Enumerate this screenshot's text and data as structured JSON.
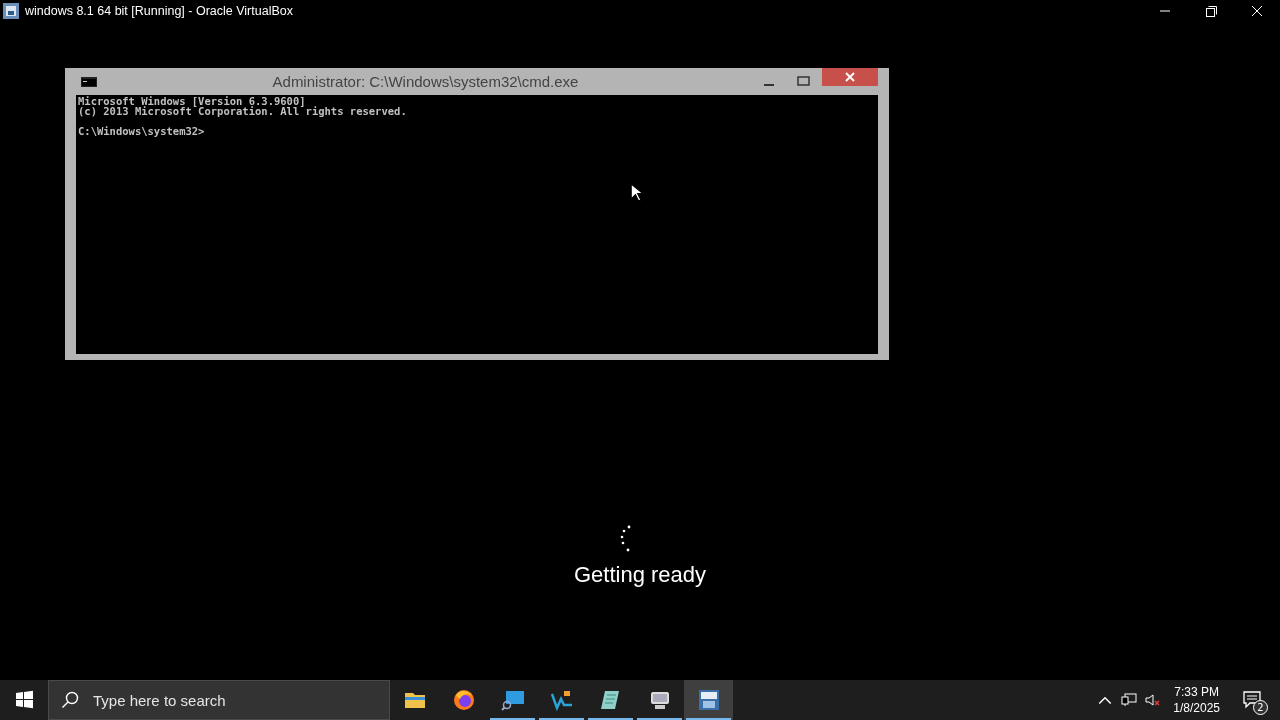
{
  "window": {
    "title": "windows 8.1 64 bit [Running] - Oracle VirtualBox"
  },
  "console_window": {
    "title": "Administrator: C:\\Windows\\system32\\cmd.exe",
    "lines": [
      "Microsoft Windows [Version 6.3.9600]",
      "(c) 2013 Microsoft Corporation. All rights reserved."
    ],
    "prompt": "C:\\Windows\\system32>"
  },
  "status": {
    "message": "Getting ready"
  },
  "taskbar": {
    "search": {
      "placeholder": "Type here to search"
    },
    "apps": [
      {
        "kind": "folder",
        "running": false,
        "selected": false
      },
      {
        "kind": "browser",
        "running": false,
        "selected": false
      },
      {
        "kind": "monitor",
        "running": true,
        "selected": false
      },
      {
        "kind": "studio",
        "running": true,
        "selected": false
      },
      {
        "kind": "notepad",
        "running": true,
        "selected": false
      },
      {
        "kind": "computer",
        "running": true,
        "selected": false
      },
      {
        "kind": "vbox",
        "running": true,
        "selected": true
      }
    ],
    "time": "7:33 PM",
    "date": "1/8/2025",
    "notifications": "2"
  }
}
